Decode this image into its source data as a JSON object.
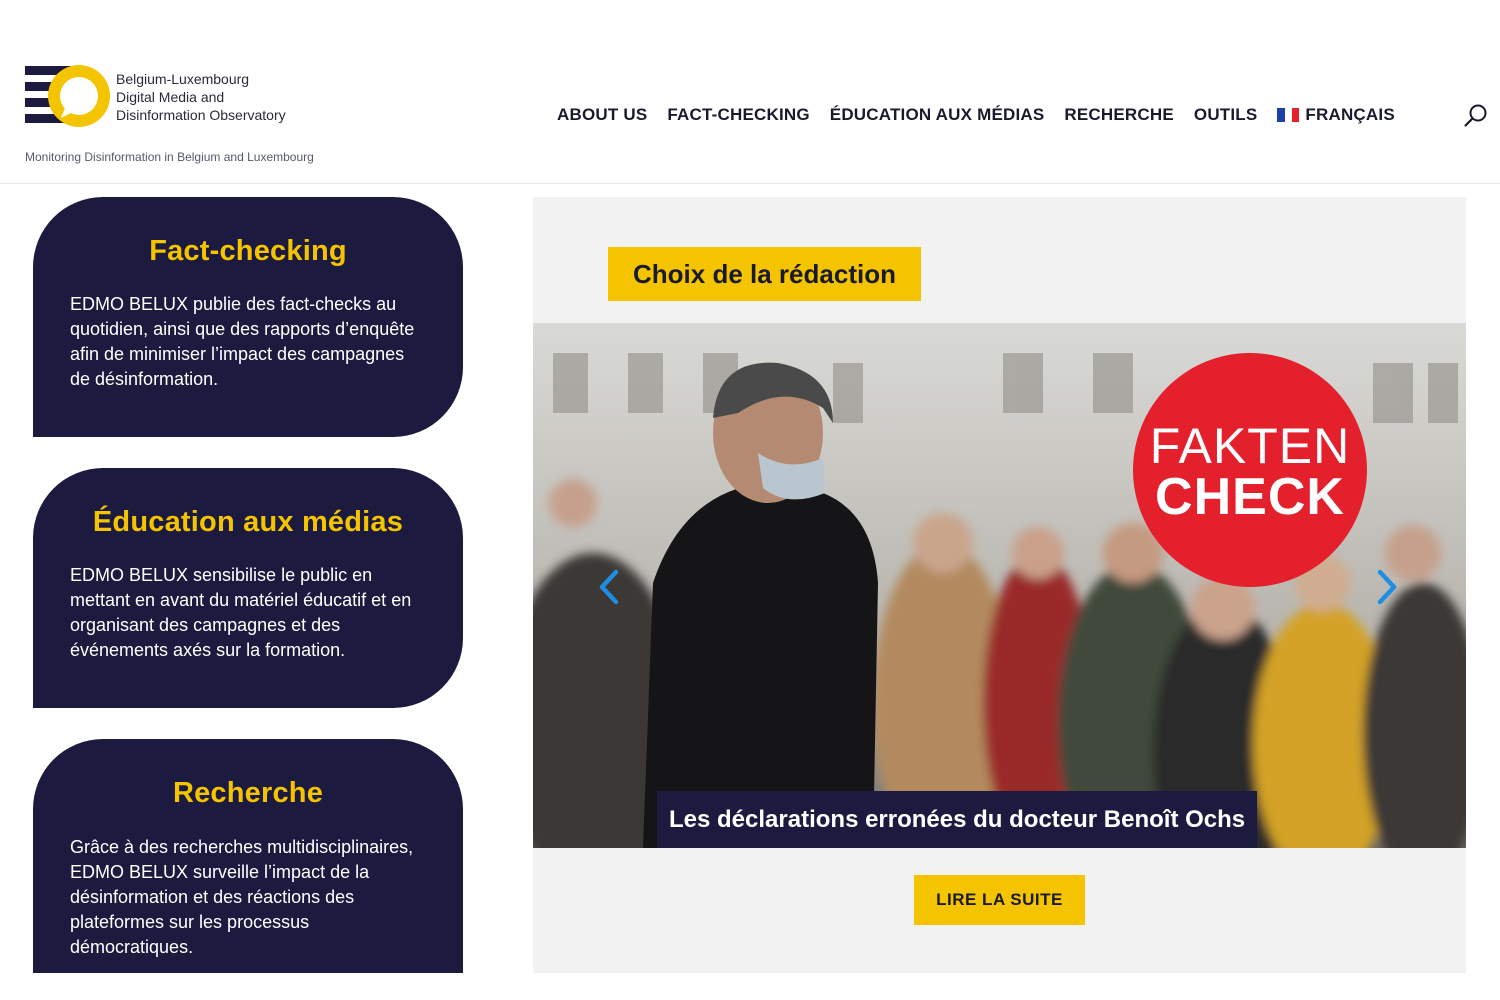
{
  "header": {
    "logo_text": "Belgium-Luxembourg\nDigital Media and\nDisinformation Observatory",
    "tagline": "Monitoring Disinformation in Belgium and Luxembourg",
    "nav": [
      "ABOUT US",
      "FACT-CHECKING",
      "ÉDUCATION AUX MÉDIAS",
      "RECHERCHE",
      "OUTILS"
    ],
    "language": "FRANÇAIS",
    "search_icon": "search-icon"
  },
  "cards": [
    {
      "title": "Fact-checking",
      "body": "EDMO BELUX publie des fact-checks au quotidien, ainsi que des rapports d’enquête afin de minimiser l’impact des campagnes de désinformation."
    },
    {
      "title": "Éducation aux médias",
      "body": "EDMO BELUX sensibilise le public en mettant en avant du matériel éducatif et en organisant des campagnes et des événements axés sur la formation."
    },
    {
      "title": "Recherche",
      "body": "Grâce à des recherches multidisciplinaires, EDMO BELUX surveille l’impact de la désinformation et des réactions des plateformes sur les processus démocratiques."
    }
  ],
  "featured": {
    "badge": "Choix de la rédaction",
    "stamp_line1": "FAKTEN",
    "stamp_line2": "CHECK",
    "headline": "Les déclarations erronées du docteur Benoît Ochs",
    "read_more": "LIRE LA SUITE"
  },
  "colors": {
    "navy": "#1c1b3f",
    "yellow": "#f5c400",
    "stamp_red": "#e3202b",
    "arrow_blue": "#1e8ee0"
  }
}
